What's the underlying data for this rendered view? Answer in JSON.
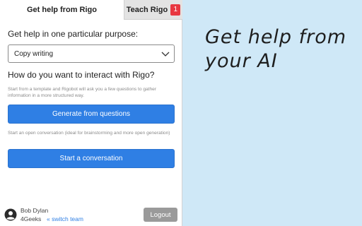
{
  "tabs": {
    "active_label": "Get help from Rigo",
    "inactive_label": "Teach Rigo",
    "badge_count": "1"
  },
  "purpose": {
    "heading": "Get help in one particular purpose:",
    "selected": "Copy writing"
  },
  "interact": {
    "heading": "How do you want to interact with Rigo?",
    "template_desc": "Start from a template and Rigobot will ask you a few questions to gather information in a more structured way.",
    "generate_label": "Generate from questions",
    "conversation_desc": "Start an open conversation (ideal for brainstorming and more open generation)",
    "conversation_label": "Start a conversation"
  },
  "footer": {
    "user_name": "Bob Dylan",
    "org_name": "4Geeks",
    "switch_label": "« switch team",
    "logout_label": "Logout"
  },
  "hero": {
    "line1": "Get help from",
    "line2": "your AI"
  },
  "colors": {
    "accent": "#2f7fe4",
    "badge": "#e8373f",
    "background": "#cfe8f7"
  },
  "icons": {
    "select_chevron": "chevron-down-icon",
    "avatar": "user-avatar-icon"
  }
}
